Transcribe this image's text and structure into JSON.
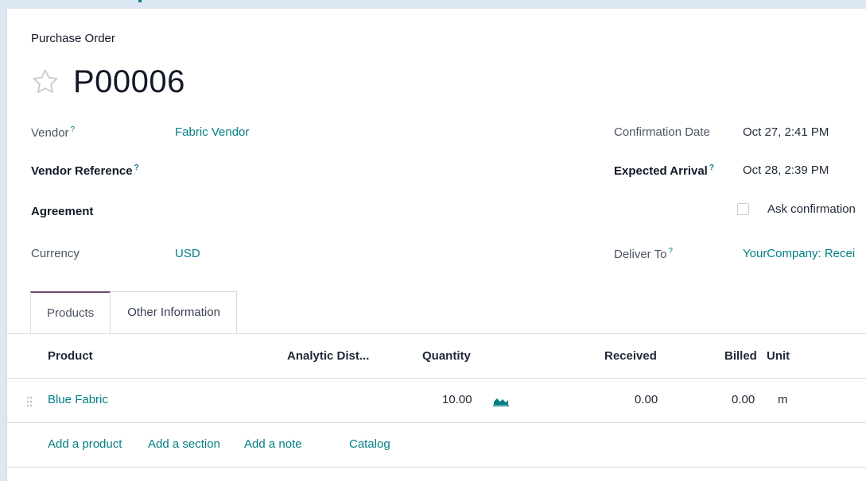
{
  "record": {
    "breadcrumb": "Purchase Order",
    "number": "P00006"
  },
  "fields": {
    "vendor": {
      "label": "Vendor",
      "help": "?",
      "value": "Fabric Vendor"
    },
    "vendor_reference": {
      "label": "Vendor Reference",
      "help": "?"
    },
    "agreement": {
      "label": "Agreement"
    },
    "currency": {
      "label": "Currency",
      "value": "USD"
    },
    "confirmation_date": {
      "label": "Confirmation Date",
      "value": "Oct 27, 2:41 PM"
    },
    "expected_arrival": {
      "label": "Expected Arrival",
      "help": "?",
      "value": "Oct 28, 2:39 PM"
    },
    "ask_confirmation": {
      "label": "Ask confirmation",
      "checked": false
    },
    "deliver_to": {
      "label": "Deliver To",
      "help": "?",
      "value": "YourCompany: Recei"
    }
  },
  "tabs": [
    {
      "label": "Products",
      "active": true
    },
    {
      "label": "Other Information",
      "active": false
    }
  ],
  "order_lines": {
    "columns": [
      "Product",
      "Analytic Dist...",
      "Quantity",
      "Received",
      "Billed",
      "Unit"
    ],
    "rows": [
      {
        "product": "Blue Fabric",
        "analytic": "",
        "quantity": "10.00",
        "received": "0.00",
        "billed": "0.00",
        "unit": "m"
      }
    ],
    "actions": [
      "Add a product",
      "Add a section",
      "Add a note",
      "Catalog"
    ]
  },
  "colors": {
    "accent": "#017e84",
    "tab_active": "#714b67",
    "background": "#dde6f3"
  },
  "icons": [
    "star-icon",
    "help-icon",
    "drag-handle-icon",
    "forecast-chart-icon"
  ]
}
